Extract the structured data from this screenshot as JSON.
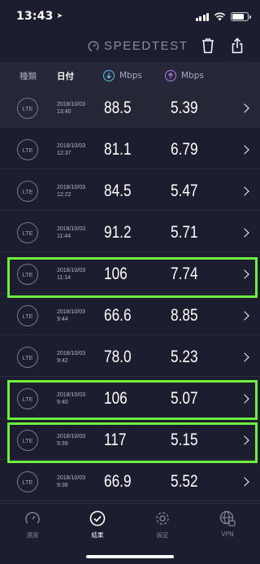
{
  "status": {
    "time": "13:43",
    "location_glyph": "➤"
  },
  "header": {
    "brand": "SPEEDTEST",
    "trash_icon": "trash-icon",
    "share_icon": "share-icon"
  },
  "columns": {
    "kind": "種類",
    "date": "日付",
    "down_unit": "Mbps",
    "up_unit": "Mbps"
  },
  "rows": [
    {
      "type": "LTE",
      "date": "2018/10/03",
      "time": "13:40",
      "down": "88.5",
      "up": "5.39"
    },
    {
      "type": "LTE",
      "date": "2018/10/03",
      "time": "12:37",
      "down": "81.1",
      "up": "6.79"
    },
    {
      "type": "LTE",
      "date": "2018/10/03",
      "time": "12:22",
      "down": "84.5",
      "up": "5.47"
    },
    {
      "type": "LTE",
      "date": "2018/10/03",
      "time": "11:44",
      "down": "91.2",
      "up": "5.71"
    },
    {
      "type": "LTE",
      "date": "2018/10/03",
      "time": "11:14",
      "down": "106",
      "up": "7.74"
    },
    {
      "type": "LTE",
      "date": "2018/10/03",
      "time": "9:44",
      "down": "66.6",
      "up": "8.85"
    },
    {
      "type": "LTE",
      "date": "2018/10/03",
      "time": "9:42",
      "down": "78.0",
      "up": "5.23"
    },
    {
      "type": "LTE",
      "date": "2018/10/03",
      "time": "9:40",
      "down": "106",
      "up": "5.07"
    },
    {
      "type": "LTE",
      "date": "2018/10/03",
      "time": "9:39",
      "down": "117",
      "up": "5.15"
    },
    {
      "type": "LTE",
      "date": "2018/10/03",
      "time": "9:38",
      "down": "66.9",
      "up": "5.52"
    }
  ],
  "tabs": [
    {
      "label": "速度",
      "icon": "speedometer-icon"
    },
    {
      "label": "結果",
      "icon": "checkmark-circle-icon"
    },
    {
      "label": "設定",
      "icon": "gear-icon"
    },
    {
      "label": "VPN",
      "icon": "globe-lock-icon"
    }
  ],
  "colors": {
    "background": "#1c1e2f",
    "download_accent": "#5ec3e6",
    "upload_accent": "#b57ae8",
    "highlight": "#6cf13d"
  }
}
